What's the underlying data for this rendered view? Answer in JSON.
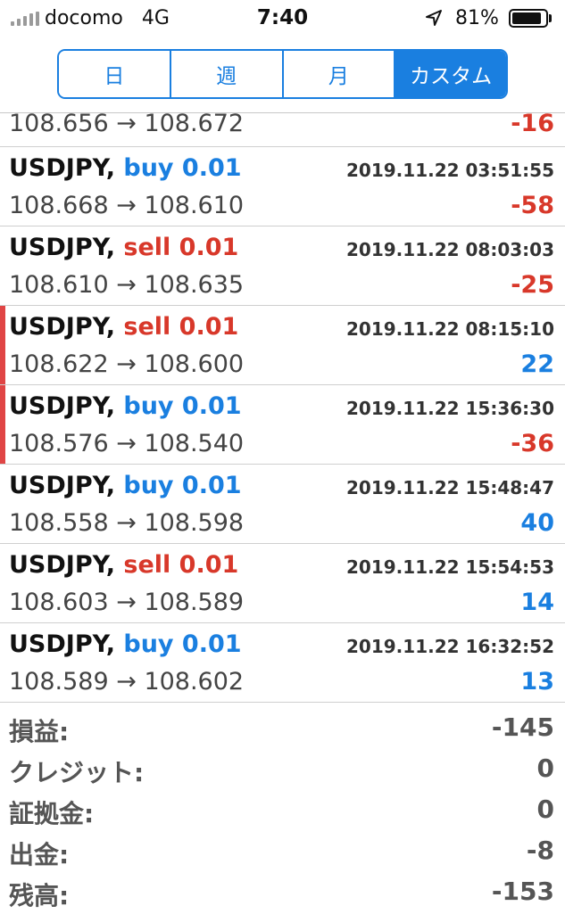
{
  "status": {
    "carrier": "docomo",
    "network": "4G",
    "time": "7:40",
    "battery": "81%"
  },
  "tabs": [
    "日",
    "週",
    "月",
    "カスタム"
  ],
  "selected_tab": "カスタム",
  "partial_row": {
    "prices": "108.656 → 108.672",
    "pl": "-16"
  },
  "trades": [
    {
      "symbol": "USDJPY,",
      "side": "buy 0.01",
      "time": "2019.11.22 03:51:55",
      "prices": "108.668 → 108.610",
      "pl": "-58"
    },
    {
      "symbol": "USDJPY,",
      "side": "sell 0.01",
      "time": "2019.11.22 08:03:03",
      "prices": "108.610 → 108.635",
      "pl": "-25"
    },
    {
      "symbol": "USDJPY,",
      "side": "sell 0.01",
      "time": "2019.11.22 08:15:10",
      "prices": "108.622 → 108.600",
      "pl": "22"
    },
    {
      "symbol": "USDJPY,",
      "side": "buy 0.01",
      "time": "2019.11.22 15:36:30",
      "prices": "108.576 → 108.540",
      "pl": "-36"
    },
    {
      "symbol": "USDJPY,",
      "side": "buy 0.01",
      "time": "2019.11.22 15:48:47",
      "prices": "108.558 → 108.598",
      "pl": "40"
    },
    {
      "symbol": "USDJPY,",
      "side": "sell 0.01",
      "time": "2019.11.22 15:54:53",
      "prices": "108.603 → 108.589",
      "pl": "14"
    },
    {
      "symbol": "USDJPY,",
      "side": "buy 0.01",
      "time": "2019.11.22 16:32:52",
      "prices": "108.589 → 108.602",
      "pl": "13"
    }
  ],
  "summary": [
    {
      "label": "損益:",
      "value": "-145"
    },
    {
      "label": "クレジット:",
      "value": "0"
    },
    {
      "label": "証拠金:",
      "value": "0"
    },
    {
      "label": "出金:",
      "value": "-8"
    },
    {
      "label": "残高:",
      "value": "-153"
    }
  ],
  "colors": {
    "accent": "#1a7fe0",
    "negative": "#d8382a",
    "marker": "#e04545"
  }
}
